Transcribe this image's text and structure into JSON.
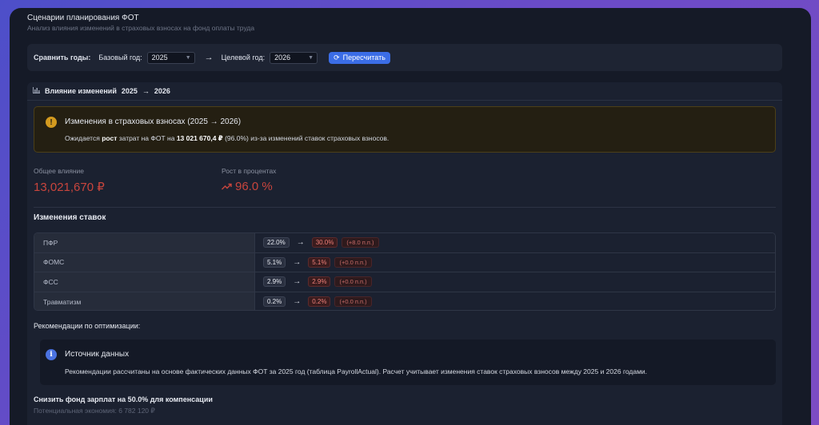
{
  "header": {
    "title": "Сценарии планирования ФОТ",
    "subtitle": "Анализ влияния изменений в страховых взносах на фонд оплаты труда"
  },
  "compare": {
    "label": "Сравнить годы:",
    "base_label": "Базовый год:",
    "base_value": "2025",
    "target_label": "Целевой год:",
    "target_value": "2026",
    "recalc_label": "Пересчитать"
  },
  "impact": {
    "title": "Влияние изменений",
    "from_year": "2025",
    "to_year": "2026",
    "warning": {
      "title": "Изменения в страховых взносах (2025 → 2026)",
      "text_prefix": "Ожидается",
      "text_bold1": "рост",
      "text_mid": "затрат на ФОТ на",
      "text_bold2": "13 021 670,4 ₽",
      "text_suffix": "(96.0%) из-за изменений ставок страховых взносов."
    },
    "metrics": {
      "total_label": "Общее влияние",
      "total_value": "13,021,670 ₽",
      "growth_label": "Рост в процентах",
      "growth_value": "96.0 %"
    }
  },
  "rates": {
    "title": "Изменения ставок",
    "rows": [
      {
        "name": "ПФР",
        "old": "22.0%",
        "new": "30.0%",
        "diff": "(+8.0 п.п.)"
      },
      {
        "name": "ФОМС",
        "old": "5.1%",
        "new": "5.1%",
        "diff": "(+0.0 п.п.)"
      },
      {
        "name": "ФСС",
        "old": "2.9%",
        "new": "2.9%",
        "diff": "(+0.0 п.п.)"
      },
      {
        "name": "Травматизм",
        "old": "0.2%",
        "new": "0.2%",
        "diff": "(+0.0 п.п.)"
      }
    ]
  },
  "recommendations": {
    "title": "Рекомендации по оптимизации:",
    "info_title": "Источник данных",
    "info_text": "Рекомендации рассчитаны на основе фактических данных ФОТ за 2025 год (таблица PayrollActual). Расчет учитывает изменения ставок страховых взносов между 2025 и 2026 годами.",
    "suggestion_title": "Снизить фонд зарплат на 50.0% для компенсации",
    "suggestion_sub": "Потенциальная экономия: 6 782 120 ₽"
  },
  "colors": {
    "accent": "#3b6de6",
    "negative": "#c9453d",
    "warning": "#d39a1f"
  },
  "icons": {
    "chart": "bar-chart-icon",
    "warning": "warning-icon",
    "info": "info-icon",
    "refresh": "refresh-icon",
    "trend": "trending-up-icon"
  }
}
